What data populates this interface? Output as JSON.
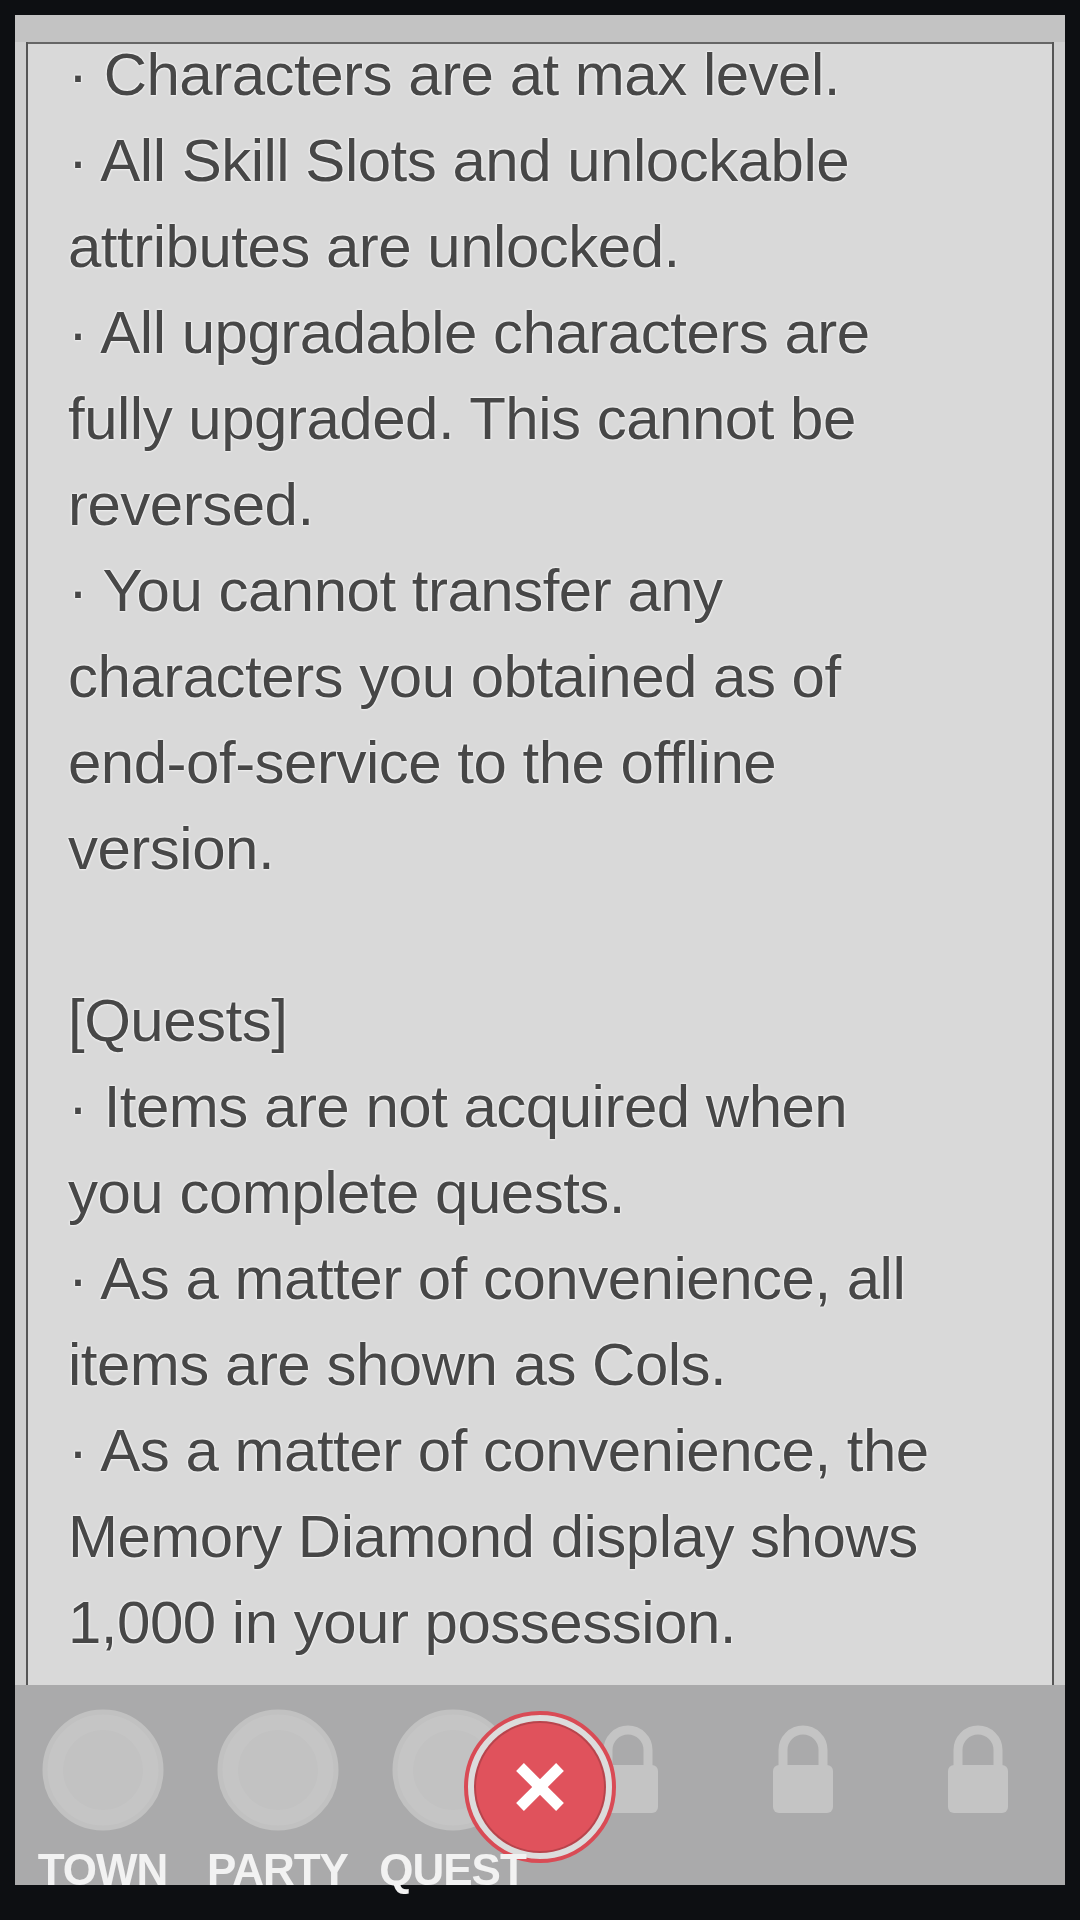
{
  "notice": {
    "blocks": [
      {
        "kind": "bullet",
        "lines": [
          "· Characters are at max level."
        ]
      },
      {
        "kind": "bullet",
        "lines": [
          "· All Skill Slots and unlockable",
          "attributes are unlocked."
        ]
      },
      {
        "kind": "bullet",
        "lines": [
          "· All upgradable characters are",
          "fully upgraded. This cannot be",
          "reversed."
        ]
      },
      {
        "kind": "bullet",
        "lines": [
          "· You cannot transfer any",
          "characters you obtained as of",
          "end-of-service to the offline",
          "version."
        ]
      },
      {
        "kind": "heading",
        "lines": [
          "[Quests]"
        ]
      },
      {
        "kind": "bullet",
        "lines": [
          "· Items are not acquired when",
          "you complete quests."
        ]
      },
      {
        "kind": "bullet",
        "lines": [
          "· As a matter of convenience, all",
          "items are shown as Cols."
        ]
      },
      {
        "kind": "bullet",
        "lines": [
          "· As a matter of convenience, the",
          "Memory Diamond display shows",
          "1,000 in your possession."
        ]
      }
    ]
  },
  "tab_bar": {
    "tabs": [
      {
        "label": "TOWN",
        "locked": false
      },
      {
        "label": "PARTY",
        "locked": false
      },
      {
        "label": "QUEST",
        "locked": false
      },
      {
        "locked": true
      },
      {
        "locked": true
      },
      {
        "locked": true
      }
    ]
  }
}
